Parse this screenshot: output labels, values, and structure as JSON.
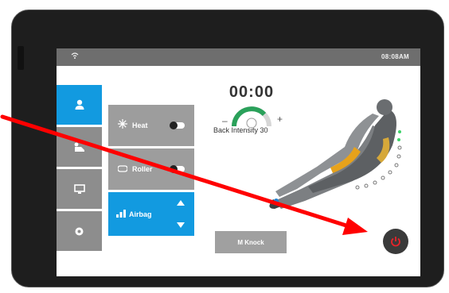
{
  "status_bar": {
    "time": "08:08AM",
    "wifi_icon": "wifi-icon"
  },
  "nav": [
    {
      "icon": "person-icon",
      "active": true
    },
    {
      "icon": "recline-icon",
      "active": false
    },
    {
      "icon": "monitor-icon",
      "active": false
    },
    {
      "icon": "settings-icon",
      "active": false
    }
  ],
  "functions": {
    "heat": {
      "label": "Heat",
      "icon": "heat-icon"
    },
    "roller": {
      "label": "Roller",
      "icon": "roller-icon"
    },
    "airbag": {
      "label": "Airbag",
      "icon": "signal-icon"
    }
  },
  "timer": {
    "value": "00:00"
  },
  "intensity": {
    "label": "Back Intensity 30",
    "minus": "–",
    "plus": "+"
  },
  "actions": {
    "mknock_label": "M Knock",
    "power_icon": "power-icon"
  },
  "colors": {
    "accent": "#129ae0",
    "panel_grey": "#9d9d9d",
    "power_red": "#e8232a",
    "annotation_arrow": "#ff0000"
  }
}
